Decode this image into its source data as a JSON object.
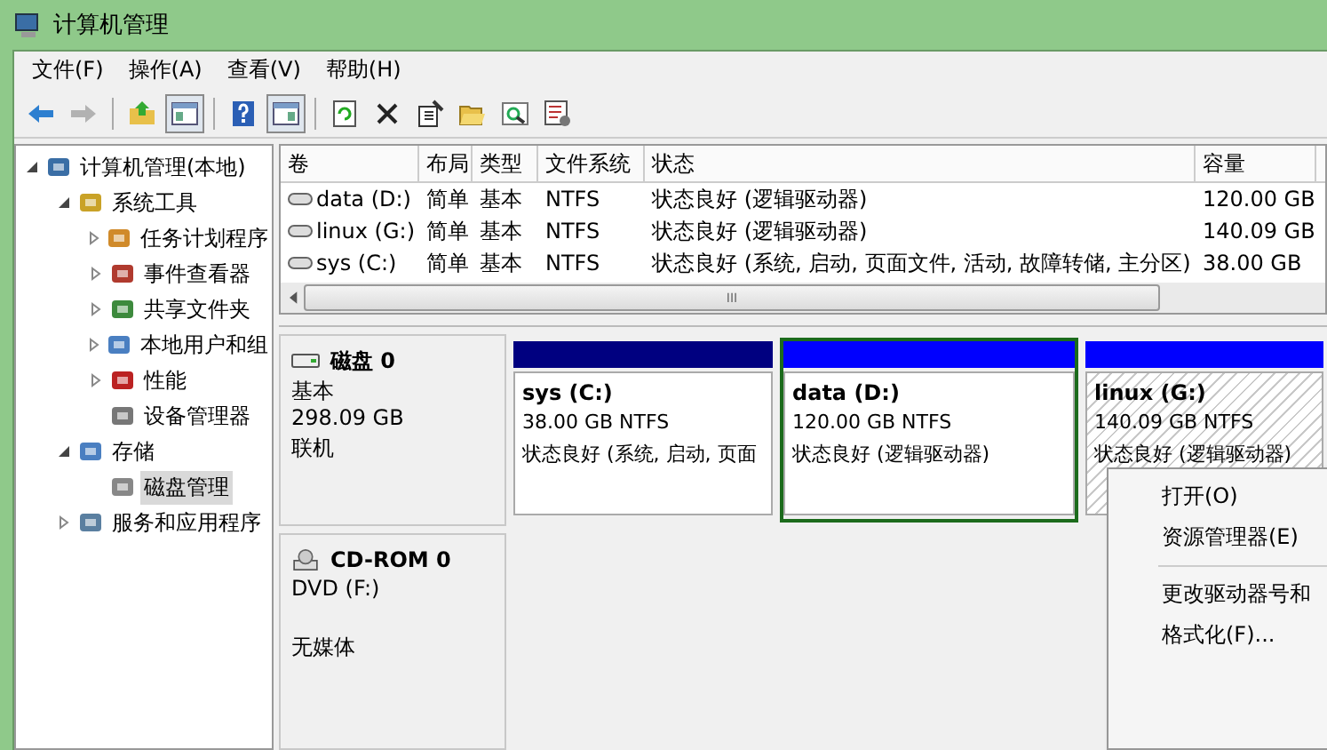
{
  "window": {
    "title": "计算机管理"
  },
  "menu": [
    "文件(F)",
    "操作(A)",
    "查看(V)",
    "帮助(H)"
  ],
  "toolbar": [
    {
      "kind": "back",
      "pressed": false,
      "disabled": false
    },
    {
      "kind": "forward",
      "pressed": false,
      "disabled": true
    },
    {
      "kind": "sep"
    },
    {
      "kind": "up",
      "pressed": false,
      "disabled": false
    },
    {
      "kind": "tree",
      "pressed": true,
      "disabled": false
    },
    {
      "kind": "sep"
    },
    {
      "kind": "help",
      "pressed": false,
      "disabled": false
    },
    {
      "kind": "pane",
      "pressed": true,
      "disabled": false
    },
    {
      "kind": "sep"
    },
    {
      "kind": "refresh",
      "pressed": false,
      "disabled": false
    },
    {
      "kind": "delete",
      "pressed": false,
      "disabled": false
    },
    {
      "kind": "properties",
      "pressed": false,
      "disabled": false
    },
    {
      "kind": "open",
      "pressed": false,
      "disabled": false
    },
    {
      "kind": "search",
      "pressed": false,
      "disabled": false
    },
    {
      "kind": "settings",
      "pressed": false,
      "disabled": false
    }
  ],
  "tree": [
    {
      "label": "计算机管理(本地)",
      "expanded": true,
      "selected": false,
      "children": [
        {
          "label": "系统工具",
          "expanded": true,
          "selected": false,
          "children": [
            {
              "label": "任务计划程序",
              "expanded": false,
              "selected": false
            },
            {
              "label": "事件查看器",
              "expanded": false,
              "selected": false
            },
            {
              "label": "共享文件夹",
              "expanded": false,
              "selected": false
            },
            {
              "label": "本地用户和组",
              "expanded": false,
              "selected": false
            },
            {
              "label": "性能",
              "expanded": false,
              "selected": false
            },
            {
              "label": "设备管理器",
              "selected": false
            }
          ]
        },
        {
          "label": "存储",
          "expanded": true,
          "selected": false,
          "children": [
            {
              "label": "磁盘管理",
              "selected": true
            }
          ]
        },
        {
          "label": "服务和应用程序",
          "expanded": false,
          "selected": false
        }
      ]
    }
  ],
  "volumes": {
    "columns": [
      "卷",
      "布局",
      "类型",
      "文件系统",
      "状态",
      "容量"
    ],
    "rows": [
      [
        "data (D:)",
        "简单",
        "基本",
        "NTFS",
        "状态良好 (逻辑驱动器)",
        "120.00 GB"
      ],
      [
        "linux (G:)",
        "简单",
        "基本",
        "NTFS",
        "状态良好 (逻辑驱动器)",
        "140.09 GB"
      ],
      [
        "sys (C:)",
        "简单",
        "基本",
        "NTFS",
        "状态良好 (系统, 启动, 页面文件, 活动, 故障转储, 主分区)",
        "38.00 GB"
      ]
    ],
    "scroll_grip": "III"
  },
  "disks": [
    {
      "kind": "disk",
      "name": "磁盘 0",
      "lines": [
        "基本",
        "298.09 GB",
        "联机"
      ],
      "partitions": [
        {
          "kind": "primary",
          "name": "sys  (C:)",
          "size": "38.00 GB NTFS",
          "status": "状态良好 (系统, 启动, 页面",
          "selected": false,
          "outlined": false
        },
        {
          "kind": "logical",
          "name": "data  (D:)",
          "size": "120.00 GB NTFS",
          "status": "状态良好 (逻辑驱动器)",
          "selected": false,
          "outlined": true
        },
        {
          "kind": "logical",
          "name": "linux  (G:)",
          "size": "140.09 GB NTFS",
          "status": "状态良好 (逻辑驱动器)",
          "selected": true,
          "outlined": false
        }
      ]
    },
    {
      "kind": "cdrom",
      "name": "CD-ROM 0",
      "lines": [
        "DVD (F:)",
        "无媒体"
      ]
    }
  ],
  "context_menu": [
    {
      "kind": "item",
      "label": "打开(O)"
    },
    {
      "kind": "item",
      "label": "资源管理器(E)"
    },
    {
      "kind": "separator"
    },
    {
      "kind": "item",
      "label": "更改驱动器号和"
    },
    {
      "kind": "item",
      "label": "格式化(F)..."
    }
  ]
}
